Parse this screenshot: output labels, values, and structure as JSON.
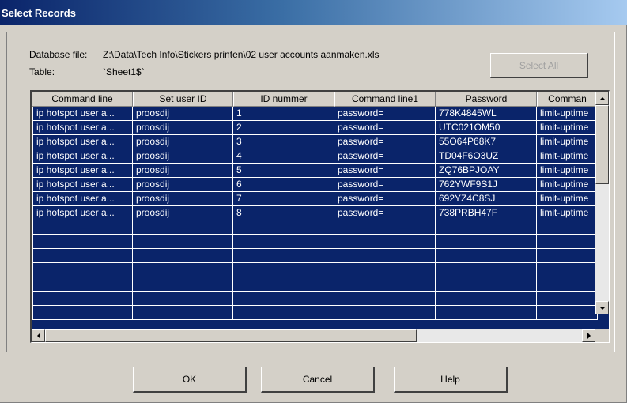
{
  "window": {
    "title": "Select Records"
  },
  "info": {
    "database_label": "Database file:",
    "database_value": "Z:\\Data\\Tech Info\\Stickers printen\\02 user accounts aanmaken.xls",
    "table_label": "Table:",
    "table_value": "`Sheet1$`"
  },
  "buttons": {
    "select_all": "Select All",
    "ok": "OK",
    "cancel": "Cancel",
    "help": "Help"
  },
  "grid": {
    "columns": [
      "Command line",
      "Set user ID",
      "ID nummer",
      "Command line1",
      "Password",
      "Comman"
    ],
    "rows": [
      [
        "ip hotspot user a...",
        "proosdij",
        "1",
        "password=",
        "778K4845WL",
        "limit-uptime"
      ],
      [
        "ip hotspot user a...",
        "proosdij",
        "2",
        "password=",
        "UTC021OM50",
        "limit-uptime"
      ],
      [
        "ip hotspot user a...",
        "proosdij",
        "3",
        "password=",
        "55O64P68K7",
        "limit-uptime"
      ],
      [
        "ip hotspot user a...",
        "proosdij",
        "4",
        "password=",
        "TD04F6O3UZ",
        "limit-uptime"
      ],
      [
        "ip hotspot user a...",
        "proosdij",
        "5",
        "password=",
        "ZQ76BPJOAY",
        "limit-uptime"
      ],
      [
        "ip hotspot user a...",
        "proosdij",
        "6",
        "password=",
        "762YWF9S1J",
        "limit-uptime"
      ],
      [
        "ip hotspot user a...",
        "proosdij",
        "7",
        "password=",
        "692YZ4C8SJ",
        "limit-uptime"
      ],
      [
        "ip hotspot user a...",
        "proosdij",
        "8",
        "password=",
        "738PRBH47F",
        "limit-uptime"
      ]
    ],
    "empty_rows": 7
  },
  "colors": {
    "selection": "#0a246a",
    "face": "#d4d0c8",
    "title_start": "#0a246a",
    "title_end": "#a6caf0"
  }
}
